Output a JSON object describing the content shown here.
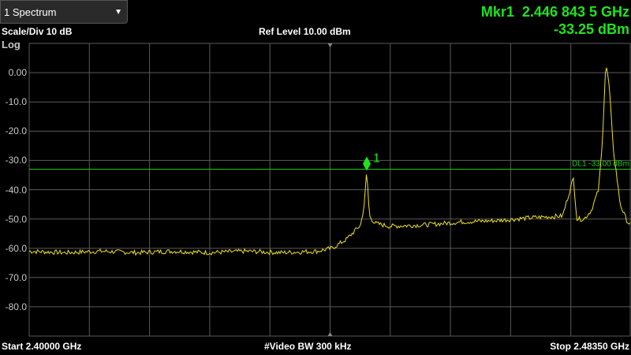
{
  "screen": {
    "dropdown": {
      "selected": "1 Spectrum",
      "arrow_icon": "chevron-down-icon"
    },
    "marker_readout": {
      "marker_name": "Mkr1",
      "frequency": "2.446 843 5 GHz",
      "amplitude": "-33.25 dBm"
    },
    "scale_div": "Scale/Div 10 dB",
    "ref_level": "Ref Level 10.00 dBm",
    "scale_type": "Log",
    "start_freq": "Start 2.40000 GHz",
    "video_bw": "#Video BW 300 kHz",
    "stop_freq": "Stop 2.48350 GHz",
    "display_line_label": "DL1 -33.00 dBm",
    "marker_number": "1",
    "y_ticks": [
      "0.00",
      "-10.0",
      "-20.0",
      "-30.0",
      "-40.0",
      "-50.0",
      "-60.0",
      "-70.0",
      "-80.0"
    ],
    "colors": {
      "trace": "#f0e020",
      "marker": "#1ee41e",
      "display_line": "#1ec81e",
      "grid": "#5a5a5a"
    }
  },
  "chart_data": {
    "type": "line",
    "x_unit": "GHz",
    "y_unit": "dBm",
    "xlim": [
      2.4,
      2.4835
    ],
    "ylim": [
      -90,
      10
    ],
    "grid": true,
    "display_line": -33.0,
    "marker": {
      "x": 2.4468435,
      "y": -33.25
    },
    "series": [
      {
        "values": [
          [
            2.4,
            -61
          ],
          [
            2.405,
            -61.5
          ],
          [
            2.41,
            -61
          ],
          [
            2.415,
            -61.5
          ],
          [
            2.42,
            -61
          ],
          [
            2.425,
            -61.5
          ],
          [
            2.43,
            -61
          ],
          [
            2.435,
            -61.5
          ],
          [
            2.44,
            -61
          ],
          [
            2.442,
            -60
          ],
          [
            2.444,
            -57
          ],
          [
            2.446,
            -52
          ],
          [
            2.4465,
            -45
          ],
          [
            2.44684,
            -33.3
          ],
          [
            2.4472,
            -49
          ],
          [
            2.448,
            -51.5
          ],
          [
            2.45,
            -52.5
          ],
          [
            2.455,
            -52
          ],
          [
            2.46,
            -51
          ],
          [
            2.465,
            -50.5
          ],
          [
            2.47,
            -49.5
          ],
          [
            2.474,
            -49
          ],
          [
            2.4755,
            -36
          ],
          [
            2.476,
            -50
          ],
          [
            2.477,
            -50
          ],
          [
            2.478,
            -47
          ],
          [
            2.479,
            -40
          ],
          [
            2.4795,
            -25
          ],
          [
            2.48,
            3.5
          ],
          [
            2.4805,
            -5
          ],
          [
            2.481,
            -25
          ],
          [
            2.482,
            -45
          ],
          [
            2.483,
            -51
          ],
          [
            2.4835,
            -52
          ]
        ]
      }
    ]
  }
}
